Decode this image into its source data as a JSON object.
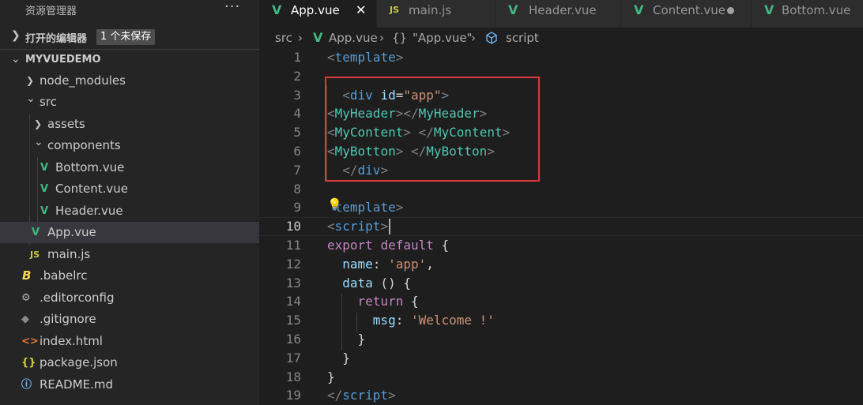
{
  "sidebar": {
    "title": "资源管理器",
    "more": "···",
    "open_editors": {
      "label": "打开的编辑器",
      "badge": "1 个未保存"
    },
    "project": "MYVUEDEMO",
    "items": [
      {
        "label": "node_modules",
        "icon": "chevron-right-icon"
      },
      {
        "label": "src",
        "icon": "chevron-down-icon"
      },
      {
        "label": "assets",
        "icon": "chevron-right-icon"
      },
      {
        "label": "components",
        "icon": "chevron-down-icon"
      },
      {
        "label": "Bottom.vue",
        "icon": "vue-icon"
      },
      {
        "label": "Content.vue",
        "icon": "vue-icon"
      },
      {
        "label": "Header.vue",
        "icon": "vue-icon"
      },
      {
        "label": "App.vue",
        "icon": "vue-icon",
        "selected": true
      },
      {
        "label": "main.js",
        "icon": "js-icon",
        "icon_text": "JS"
      },
      {
        "label": ".babelrc",
        "icon": "babel-icon",
        "icon_text": "B"
      },
      {
        "label": ".editorconfig",
        "icon": "gear-icon",
        "icon_text": "⚙"
      },
      {
        "label": ".gitignore",
        "icon": "git-icon",
        "icon_text": "◆"
      },
      {
        "label": "index.html",
        "icon": "html-icon",
        "icon_text": "<>"
      },
      {
        "label": "package.json",
        "icon": "json-icon",
        "icon_text": "{}"
      },
      {
        "label": "README.md",
        "icon": "info-icon",
        "icon_text": "ⓘ"
      }
    ]
  },
  "tabs": [
    {
      "label": "App.vue",
      "icon": "vue-icon",
      "active": true,
      "close": "✕"
    },
    {
      "label": "main.js",
      "icon": "js-icon",
      "icon_text": "JS"
    },
    {
      "label": "Header.vue",
      "icon": "vue-icon"
    },
    {
      "label": "Content.vue",
      "icon": "vue-icon",
      "dirty": true
    },
    {
      "label": "Bottom.vue",
      "icon": "vue-icon"
    }
  ],
  "breadcrumbs": {
    "folder": "src",
    "sep": "›",
    "file": "App.vue",
    "braces": "{}",
    "symbol": "\"App.vue\"",
    "symbol_icon": "cube-icon",
    "section": "script"
  },
  "editor": {
    "current_line": 10,
    "line_numbers": [
      "1",
      "2",
      "3",
      "4",
      "5",
      "6",
      "7",
      "8",
      "9",
      "10",
      "11",
      "12",
      "13",
      "14",
      "15",
      "16",
      "17",
      "18",
      "19"
    ],
    "lines": [
      [
        [
          "t-punc",
          "<"
        ],
        [
          "t-tag",
          "template"
        ],
        [
          "t-punc",
          ">"
        ]
      ],
      [],
      [
        [
          "t-txt",
          "  "
        ],
        [
          "t-punc",
          "<"
        ],
        [
          "t-tag",
          "div"
        ],
        [
          "t-txt",
          " "
        ],
        [
          "t-attr",
          "id"
        ],
        [
          "t-txt",
          "="
        ],
        [
          "t-str",
          "\"app\""
        ],
        [
          "t-punc",
          ">"
        ]
      ],
      [
        [
          "t-punc",
          "<"
        ],
        [
          "t-comp",
          "MyHeader"
        ],
        [
          "t-punc",
          "></"
        ],
        [
          "t-comp",
          "MyHeader"
        ],
        [
          "t-punc",
          ">"
        ]
      ],
      [
        [
          "t-punc",
          "<"
        ],
        [
          "t-comp",
          "MyContent"
        ],
        [
          "t-punc",
          ">"
        ],
        [
          "t-txt",
          " "
        ],
        [
          "t-punc",
          "</"
        ],
        [
          "t-comp",
          "MyContent"
        ],
        [
          "t-punc",
          ">"
        ]
      ],
      [
        [
          "t-punc",
          "<"
        ],
        [
          "t-comp",
          "MyBotton"
        ],
        [
          "t-punc",
          ">"
        ],
        [
          "t-txt",
          " "
        ],
        [
          "t-punc",
          "</"
        ],
        [
          "t-comp",
          "MyBotton"
        ],
        [
          "t-punc",
          ">"
        ]
      ],
      [
        [
          "t-txt",
          "  "
        ],
        [
          "t-punc",
          "</"
        ],
        [
          "t-tag",
          "div"
        ],
        [
          "t-punc",
          ">"
        ]
      ],
      [],
      [
        [
          "t-txt",
          " "
        ],
        [
          "t-tag",
          "template"
        ],
        [
          "t-punc",
          ">"
        ]
      ],
      [
        [
          "t-punc",
          "<"
        ],
        [
          "t-tag",
          "script"
        ],
        [
          "t-punc",
          ">"
        ]
      ],
      [
        [
          "t-kw",
          "export"
        ],
        [
          "t-txt",
          " "
        ],
        [
          "t-kw",
          "default"
        ],
        [
          "t-txt",
          " {"
        ]
      ],
      [
        [
          "t-txt",
          "  "
        ],
        [
          "t-key",
          "name"
        ],
        [
          "t-txt",
          ": "
        ],
        [
          "t-str",
          "'app'"
        ],
        [
          "t-txt",
          ","
        ]
      ],
      [
        [
          "t-txt",
          "  "
        ],
        [
          "t-key",
          "data"
        ],
        [
          "t-txt",
          " () {"
        ]
      ],
      [
        [
          "t-txt",
          "    "
        ],
        [
          "t-kw",
          "return"
        ],
        [
          "t-txt",
          " {"
        ]
      ],
      [
        [
          "t-txt",
          "      "
        ],
        [
          "t-key",
          "msg"
        ],
        [
          "t-txt",
          ": "
        ],
        [
          "t-str",
          "'Welcome !'"
        ]
      ],
      [
        [
          "t-txt",
          "    }"
        ]
      ],
      [
        [
          "t-txt",
          "  }"
        ]
      ],
      [
        [
          "t-txt",
          "}"
        ]
      ],
      [
        [
          "t-punc",
          "</"
        ],
        [
          "t-tag",
          "script"
        ],
        [
          "t-punc",
          ">"
        ]
      ]
    ]
  },
  "colors": {
    "vue": "#41b883",
    "js": "#cbcb41",
    "highlight_box": "#e0393e",
    "lightbulb": "#ffcc00"
  }
}
